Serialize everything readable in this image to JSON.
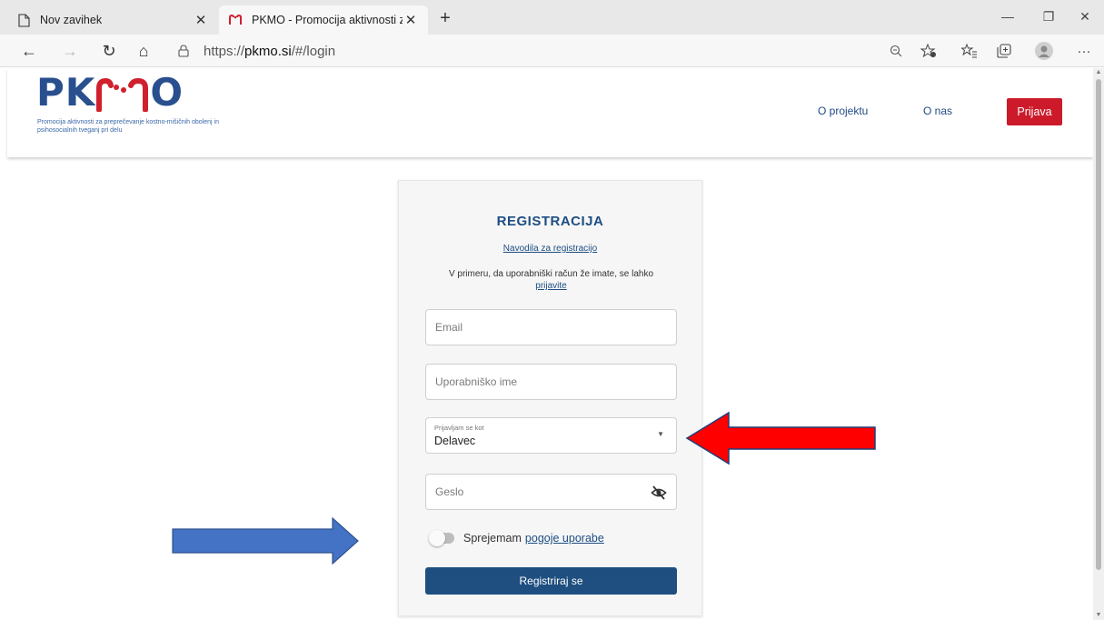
{
  "browser": {
    "tabs": [
      {
        "title": "Nov zavihek",
        "icon": "page-icon",
        "active": false
      },
      {
        "title": "PKMO - Promocija aktivnosti za pre",
        "icon": "pkmo-favicon",
        "active": true
      }
    ],
    "new_tab": "+",
    "window_controls": {
      "minimize": "—",
      "restore": "❐",
      "close": "✕"
    },
    "nav": {
      "back": "←",
      "forward": "→",
      "reload": "↻",
      "home": "⌂"
    },
    "url_prefix": "https://",
    "url_host": "pkmo.si",
    "url_path": "/#/login",
    "more": "···"
  },
  "site": {
    "logo_left": "PK",
    "logo_right": "O",
    "tagline": "Promocija aktivnosti za preprečevanje kostno-mišičnih obolenj in psihosocialnih tveganj pri delu",
    "nav": [
      "O projektu",
      "O nas"
    ],
    "login_button": "Prijava",
    "brand_blue": "#2a4f8e",
    "brand_red": "#cc1a2a"
  },
  "form": {
    "title": "REGISTRACIJA",
    "guide_link": "Navodila za registracijo",
    "info_text": "V primeru, da uporabniški račun že imate, se lahko",
    "info_link": "prijavite",
    "email_placeholder": "Email",
    "username_placeholder": "Uporabniško ime",
    "role_label": "Prijavljam se kot",
    "role_value": "Delavec",
    "password_placeholder": "Geslo",
    "terms_text": "Sprejemam",
    "terms_link": "pogoje uporabe",
    "terms_accepted": false,
    "submit": "Registriraj se",
    "button_color": "#1e4f80"
  },
  "annotations": {
    "red_arrow_color": "#ff0000",
    "blue_arrow_color": "#4472c4"
  }
}
